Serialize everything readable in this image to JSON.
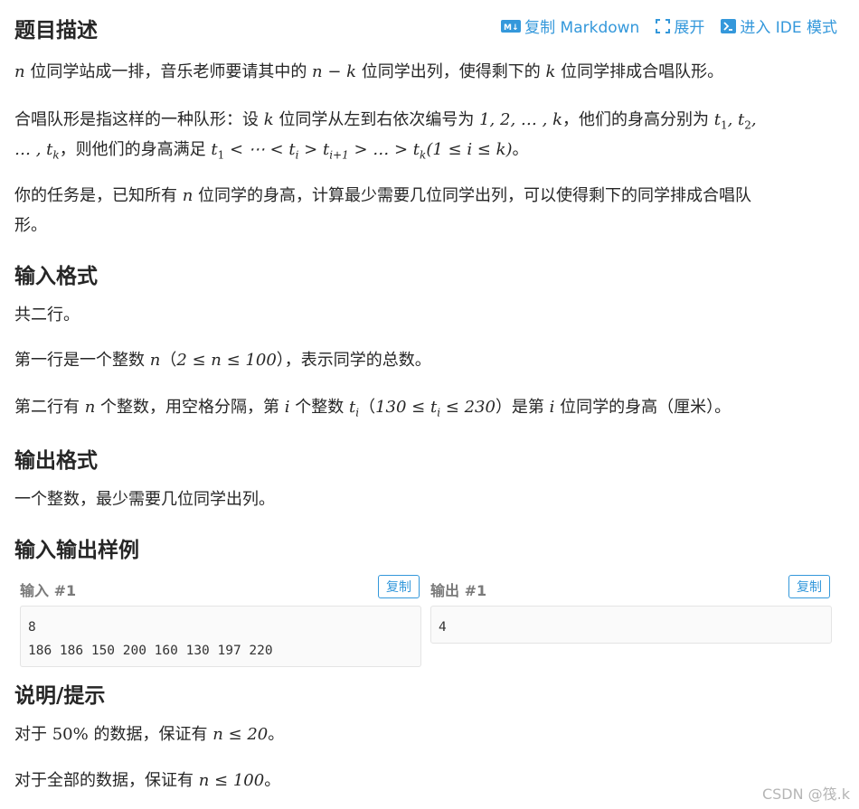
{
  "toolbar": {
    "copy_markdown": "复制 Markdown",
    "expand": "展开",
    "enter_ide": "进入 IDE 模式",
    "accent_color": "#3498db"
  },
  "sections": {
    "description": "题目描述",
    "input_format": "输入格式",
    "output_format": "输出格式",
    "samples": "输入输出样例",
    "hint": "说明/提示"
  },
  "description": {
    "p1": {
      "var_n": "n",
      "t1": " 位同学站成一排，音乐老师要请其中的 ",
      "expr": "n − k",
      "t2": " 位同学出列，使得剩下的 ",
      "var_k": "k",
      "t3": " 位同学排成合唱队形。"
    },
    "p2": {
      "t1": "合唱队形是指这样的一种队形：设 ",
      "var_k": "k",
      "t2": " 位同学从左到右依次编号为 ",
      "seq": "1, 2, … , k",
      "t3": "，他们的身高分别为 ",
      "t_1": "t",
      "sub1": "1",
      "comma": ", t",
      "sub2": "2",
      "tail": ",",
      "line2_start": "… , t",
      "subk": "k",
      "t4": "，则他们的身高满足 ",
      "ineq_a": "t",
      "ineq_sub1": "1",
      "ineq_b": " < ⋯ < t",
      "ineq_subi": "i",
      "ineq_c": " > t",
      "ineq_subi1": "i+1",
      "ineq_d": " > … > t",
      "ineq_subk": "k",
      "ineq_e": "(1 ≤ i ≤ k)",
      "t5": "。"
    },
    "p3": {
      "t1": "你的任务是，已知所有 ",
      "var_n": "n",
      "t2": " 位同学的身高，计算最少需要几位同学出列，可以使得剩下的同学排成合唱队",
      "line2": "形。"
    }
  },
  "input_format": {
    "l1": "共二行。",
    "l2": {
      "t1": "第一行是一个整数 ",
      "var_n": "n",
      "t2": "（",
      "range": "2 ≤ n ≤ 100",
      "t3": "），表示同学的总数。"
    },
    "l3": {
      "t1": "第二行有 ",
      "var_n": "n",
      "t2": " 个整数，用空格分隔，第 ",
      "var_i": "i",
      "t3": " 个整数 ",
      "ti": "t",
      "ti_sub": "i",
      "t4": "（",
      "range": "130 ≤ t",
      "range_sub": "i",
      "range_end": " ≤ 230",
      "t5": "）是第 ",
      "var_i2": "i",
      "t6": " 位同学的身高（厘米）。"
    }
  },
  "output_format": {
    "l1": "一个整数，最少需要几位同学出列。"
  },
  "samples": {
    "input_label": "输入 #1",
    "output_label": "输出 #1",
    "copy_label": "复制",
    "input_text": "8\n186 186 150 200 160 130 197 220",
    "output_text": "4"
  },
  "hint": {
    "l1": {
      "t1": "对于 ",
      "pct": "50%",
      "t2": " 的数据，保证有 ",
      "cond": "n ≤ 20",
      "t3": "。"
    },
    "l2": {
      "t1": "对于全部的数据，保证有 ",
      "cond": "n ≤ 100",
      "t3": "。"
    }
  },
  "watermark": "CSDN @筏.k"
}
